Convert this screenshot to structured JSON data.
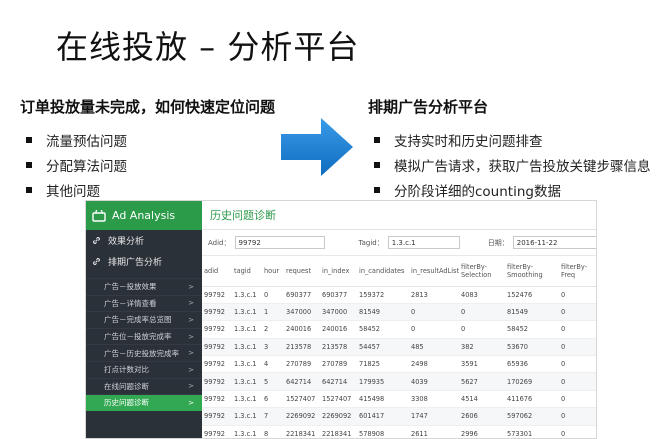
{
  "slide": {
    "title": "在线投放 – 分析平台"
  },
  "left": {
    "heading": "订单投放量未完成，如何快速定位问题",
    "items": [
      "流量预估问题",
      "分配算法问题",
      "其他问题"
    ]
  },
  "right": {
    "heading": "排期广告分析平台",
    "items": [
      "支持实时和历史问题排查",
      "模拟广告请求，获取广告投放关键步骤信息",
      "分阶段详细的counting数据"
    ]
  },
  "colors": {
    "arrow": "#1a7fd6",
    "brand_green": "#2b9a49",
    "sidebar_dark": "#2b3139"
  },
  "app": {
    "brand": "Ad Analysis",
    "nav": [
      {
        "label": "效果分析",
        "icon": "link-icon"
      },
      {
        "label": "排期广告分析",
        "icon": "link-icon"
      }
    ],
    "subnav": [
      {
        "label": "广告－投放效果",
        "arrow": ">"
      },
      {
        "label": "广告－详情查看",
        "arrow": ">"
      },
      {
        "label": "广告－完成率总览图",
        "arrow": ">"
      },
      {
        "label": "广告位－投放完成率",
        "arrow": ">"
      },
      {
        "label": "广告－历史投放完成率",
        "arrow": ">"
      },
      {
        "label": "打点计数对比",
        "arrow": ">"
      },
      {
        "label": "在线问题诊断",
        "arrow": ">"
      },
      {
        "label": "历史问题诊断",
        "arrow": ">"
      }
    ],
    "header_title": "历史问题诊断",
    "filters": {
      "adid_label": "Adid：",
      "adid_value": "99792",
      "tagid_label": "Tagid：",
      "tagid_value": "1.3.c.1",
      "date_label": "日期：",
      "date_value": "2016-11-22"
    },
    "columns": [
      "adid",
      "tagid",
      "hour",
      "request",
      "in_index",
      "in_candidates",
      "in_resultAdList",
      "filterBy-Selection",
      "filterBy-Smoothing",
      "filterBy-Freq"
    ],
    "rows": [
      [
        "99792",
        "1.3.c.1",
        "0",
        "690377",
        "690377",
        "159372",
        "2813",
        "4083",
        "152476",
        "0"
      ],
      [
        "99792",
        "1.3.c.1",
        "1",
        "347000",
        "347000",
        "81549",
        "0",
        "0",
        "81549",
        "0"
      ],
      [
        "99792",
        "1.3.c.1",
        "2",
        "240016",
        "240016",
        "58452",
        "0",
        "0",
        "58452",
        "0"
      ],
      [
        "99792",
        "1.3.c.1",
        "3",
        "213578",
        "213578",
        "54457",
        "485",
        "382",
        "53670",
        "0"
      ],
      [
        "99792",
        "1.3.c.1",
        "4",
        "270789",
        "270789",
        "71825",
        "2498",
        "3591",
        "65936",
        "0"
      ],
      [
        "99792",
        "1.3.c.1",
        "5",
        "642714",
        "642714",
        "179935",
        "4039",
        "5627",
        "170269",
        "0"
      ],
      [
        "99792",
        "1.3.c.1",
        "6",
        "1527407",
        "1527407",
        "415498",
        "3308",
        "4514",
        "411676",
        "0"
      ],
      [
        "99792",
        "1.3.c.1",
        "7",
        "2269092",
        "2269092",
        "601417",
        "1747",
        "2606",
        "597062",
        "0"
      ],
      [
        "99792",
        "1.3.c.1",
        "8",
        "2218341",
        "2218341",
        "578908",
        "2611",
        "2996",
        "573301",
        "0"
      ]
    ]
  }
}
